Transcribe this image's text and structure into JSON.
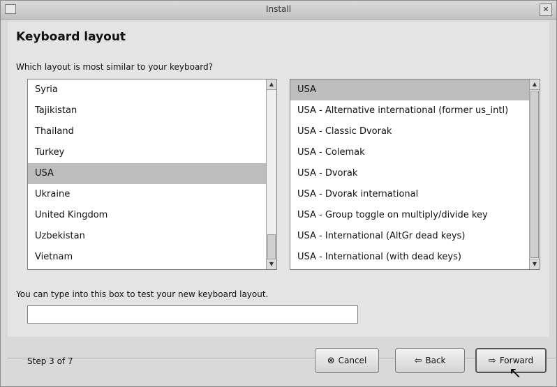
{
  "window": {
    "title": "Install",
    "close_glyph": "✕"
  },
  "page": {
    "heading": "Keyboard layout",
    "question": "Which layout is most similar to your keyboard?",
    "test_hint": "You can type into this box to test your new keyboard layout.",
    "test_input_value": "",
    "step": "Step 3 of 7"
  },
  "countries": [
    {
      "label": "Syria",
      "selected": false
    },
    {
      "label": "Tajikistan",
      "selected": false
    },
    {
      "label": "Thailand",
      "selected": false
    },
    {
      "label": "Turkey",
      "selected": false
    },
    {
      "label": "USA",
      "selected": true
    },
    {
      "label": "Ukraine",
      "selected": false
    },
    {
      "label": "United Kingdom",
      "selected": false
    },
    {
      "label": "Uzbekistan",
      "selected": false
    },
    {
      "label": "Vietnam",
      "selected": false
    }
  ],
  "variants": [
    {
      "label": "USA",
      "selected": true
    },
    {
      "label": "USA - Alternative international (former us_intl)",
      "selected": false
    },
    {
      "label": "USA - Classic Dvorak",
      "selected": false
    },
    {
      "label": "USA - Colemak",
      "selected": false
    },
    {
      "label": "USA - Dvorak",
      "selected": false
    },
    {
      "label": "USA - Dvorak international",
      "selected": false
    },
    {
      "label": "USA - Group toggle on multiply/divide key",
      "selected": false
    },
    {
      "label": "USA - International (AltGr dead keys)",
      "selected": false
    },
    {
      "label": "USA - International (with dead keys)",
      "selected": false
    }
  ],
  "buttons": {
    "cancel": {
      "label": "Cancel",
      "icon": "cancel-icon",
      "glyph": "⊗"
    },
    "back": {
      "label": "Back",
      "icon": "back-arrow-icon",
      "glyph": "⇦"
    },
    "forward": {
      "label": "Forward",
      "icon": "forward-arrow-icon",
      "glyph": "⇨"
    }
  },
  "scroll": {
    "up_glyph": "▲",
    "down_glyph": "▼"
  },
  "cursor_glyph": "↖"
}
